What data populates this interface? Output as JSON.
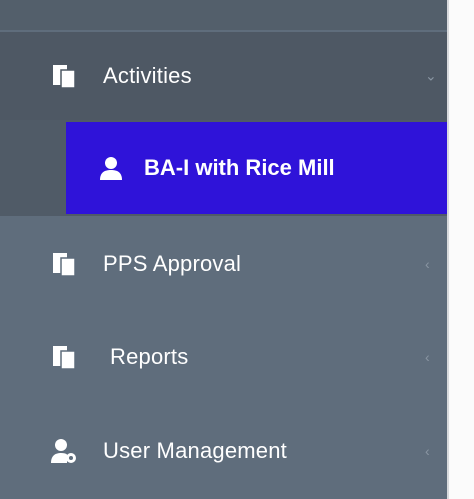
{
  "sidebar": {
    "items": [
      {
        "label": "Activities",
        "icon": "copy-icon",
        "chevron": "⌄",
        "expanded": true
      },
      {
        "label": "PPS Approval",
        "icon": "copy-icon",
        "chevron": "‹"
      },
      {
        "label": "Reports",
        "icon": "copy-icon",
        "chevron": "‹"
      },
      {
        "label": "User Management",
        "icon": "user-gear-icon",
        "chevron": "‹"
      }
    ],
    "submenu": {
      "label": "BA-I with Rice Mill",
      "icon": "user-icon",
      "active": true
    }
  },
  "colors": {
    "sidebar_bg": "#5f6d7c",
    "open_group_bg": "#4e5864",
    "active_item_bg": "#2f13d9",
    "text": "#ffffff"
  }
}
